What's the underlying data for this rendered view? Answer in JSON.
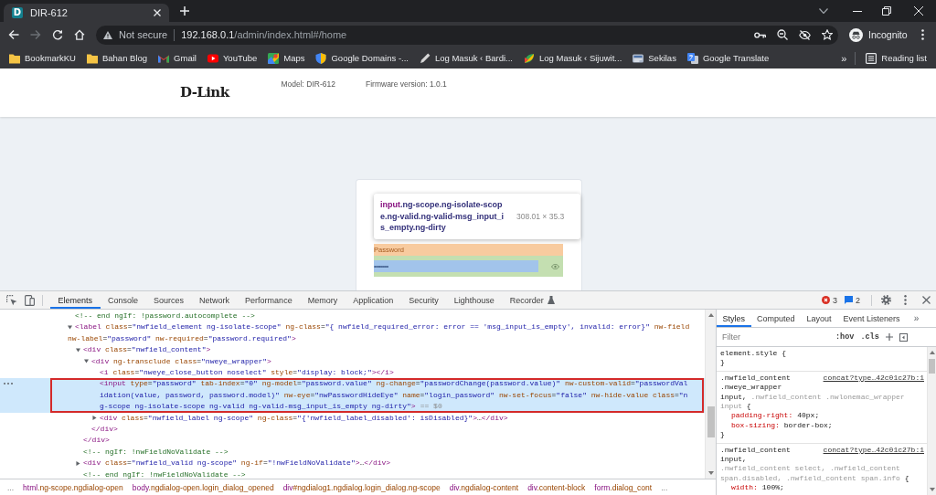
{
  "browser": {
    "tabs": [
      {
        "title": "DIR-612",
        "icon_letter": "D",
        "selected": true
      }
    ],
    "address": {
      "security": "Not secure",
      "host": "192.168.0.1",
      "path": "/admin/index.html#/home"
    },
    "profile": "Incognito",
    "bookmarks": [
      {
        "label": "BookmarkKU",
        "kind": "folder"
      },
      {
        "label": "Bahan Blog",
        "kind": "folder"
      },
      {
        "label": "Gmail",
        "kind": "mail"
      },
      {
        "label": "YouTube",
        "kind": "video"
      },
      {
        "label": "Maps",
        "kind": "map"
      },
      {
        "label": "Google Domains -...",
        "kind": "shield"
      },
      {
        "label": "Log Masuk ‹ Bardi...",
        "kind": "pen"
      },
      {
        "label": "Log Masuk ‹ Sijuwit...",
        "kind": "leaf"
      },
      {
        "label": "Sekilas",
        "kind": "news"
      },
      {
        "label": "Google Translate",
        "kind": "translate"
      }
    ],
    "bookmarks_overflow": "»",
    "reading_list": "Reading list"
  },
  "page": {
    "logo": "D-Link",
    "model": "Model: DIR-612",
    "firmware": "Firmware version: 1.0.1",
    "inspect_tooltip": {
      "tag": "input",
      "classes": ".ng-scope.ng-isolate-scope.ng-valid.ng-valid-msg_input_is_empty.ng-dirty",
      "size": "308.01 × 35.3"
    },
    "password_field": {
      "label": "Password",
      "value": "••••••••"
    }
  },
  "devtools": {
    "tabs": [
      {
        "label": "Elements",
        "selected": true,
        "experimental": false
      },
      {
        "label": "Console",
        "selected": false,
        "experimental": false
      },
      {
        "label": "Sources",
        "selected": false,
        "experimental": false
      },
      {
        "label": "Network",
        "selected": false,
        "experimental": false
      },
      {
        "label": "Performance",
        "selected": false,
        "experimental": false
      },
      {
        "label": "Memory",
        "selected": false,
        "experimental": false
      },
      {
        "label": "Application",
        "selected": false,
        "experimental": false
      },
      {
        "label": "Security",
        "selected": false,
        "experimental": false
      },
      {
        "label": "Lighthouse",
        "selected": false,
        "experimental": false
      },
      {
        "label": "Recorder",
        "selected": false,
        "experimental": true
      }
    ],
    "error_count": "3",
    "message_count": "2",
    "dom_tree": [
      {
        "kind": "comment",
        "selected": false,
        "lines": [
          "<!-- end ngIf: !password.autocomplete -->"
        ]
      },
      {
        "kind": "element",
        "selected": false,
        "expanded": true,
        "lines": [
          "<label class=\"nwfield_element ng-isolate-scope\" ng-class=\"{ nwfield_required_error: error == 'msg_input_is_empty', invalid: error}\" nw-field",
          "nw-label=\"password\" nw-required=\"password.required\">"
        ],
        "children": [
          {
            "kind": "element",
            "selected": false,
            "expanded": true,
            "lines": [
              "<div class=\"nwfield_content\">"
            ],
            "children": [
              {
                "kind": "element",
                "selected": false,
                "expanded": true,
                "lines": [
                  "<div ng-transclude class=\"nweye_wrapper\">"
                ],
                "children": [
                  {
                    "kind": "leaf",
                    "selected": false,
                    "lines": [
                      "<i class=\"nweye_close_button noselect\" style=\"display: block;\"></i>"
                    ]
                  },
                  {
                    "kind": "leaf",
                    "selected": true,
                    "lines": [
                      "<input type=\"password\" tab-index=\"0\" ng-model=\"password.value\" ng-change=\"passwordChange(password.value)\" nw-custom-valid=\"passwordVal",
                      "idation(value, password, password.model)\" nw-eye=\"nwPasswordHideEye\" name=\"login_password\" nw-set-focus=\"false\" nw-hide-value class=\"n",
                      "g-scope ng-isolate-scope ng-valid ng-valid-msg_input_is_empty ng-dirty\">"
                    ],
                    "marker": "== $0"
                  },
                  {
                    "kind": "element",
                    "selected": false,
                    "expanded": false,
                    "lines": [
                      "<div class=\"nwfield_label ng-scope\" ng-class=\"{'nwfield_label_disabled': isDisabled}\">…</div>"
                    ]
                  }
                ],
                "close": "</div>"
              }
            ],
            "close": "</div>"
          },
          {
            "kind": "comment",
            "selected": false,
            "lines": [
              "<!-- ngIf: !nwFieldNoValidate -->"
            ]
          },
          {
            "kind": "element",
            "selected": false,
            "expanded": false,
            "lines": [
              "<div class=\"nwfield_valid ng-scope\" ng-if=\"!nwFieldNoValidate\">…</div>"
            ]
          },
          {
            "kind": "comment",
            "selected": false,
            "lines": [
              "<!-- end ngIf: !nwFieldNoValidate -->"
            ]
          }
        ]
      }
    ],
    "breadcrumbs": {
      "scroll_left": "...",
      "items": [
        {
          "tag": "html",
          "rest": ".ng-scope.ngdialog-open"
        },
        {
          "tag": "body",
          "rest": ".ngdialog-open.login_dialog_opened"
        },
        {
          "tag": "div",
          "rest": "#ngdialog1.ngdialog.login_dialog.ng-scope"
        },
        {
          "tag": "div",
          "rest": ".ngdialog-content"
        },
        {
          "tag": "div",
          "rest": ".content-block"
        },
        {
          "tag": "form",
          "rest": ".dialog_cont"
        }
      ],
      "scroll_right": "..."
    },
    "styles_pane": {
      "tabs": [
        {
          "label": "Styles",
          "selected": true
        },
        {
          "label": "Computed",
          "selected": false
        },
        {
          "label": "Layout",
          "selected": false
        },
        {
          "label": "Event Listeners",
          "selected": false
        }
      ],
      "tabs_overflow": "»",
      "filter": {
        "placeholder": "Filter"
      },
      "hov": ":hov",
      "cls": ".cls",
      "rules": [
        {
          "selector_lines": [
            [
              {
                "text": "element.style {",
                "matched": true
              }
            ]
          ],
          "close": "}"
        },
        {
          "source": "concat?type…42c01c27b:1",
          "selector_lines": [
            [
              {
                "text": ".nwfield_content",
                "matched": true
              }
            ],
            [
              {
                "text": ".nweye_wrapper",
                "matched": true
              }
            ],
            [
              {
                "text": "input,",
                "matched": true
              },
              {
                "text": " .nwfield_content .nwlonemac_wrapper",
                "matched": false
              }
            ],
            [
              {
                "text": "input",
                "matched": false
              },
              {
                "text": " {",
                "matched": true
              }
            ]
          ],
          "properties": [
            {
              "name": "padding-right:",
              "value": "40px;"
            },
            {
              "name": "box-sizing:",
              "value": "border-box;"
            }
          ],
          "close": "}"
        },
        {
          "source": "concat?type…42c01c27b:1",
          "selector_lines": [
            [
              {
                "text": ".nwfield_content",
                "matched": true
              }
            ],
            [
              {
                "text": "input,",
                "matched": true
              }
            ],
            [
              {
                "text": ".nwfield_content select, .nwfield_content",
                "matched": false
              }
            ],
            [
              {
                "text": "span.disabled, .nwfield_content span.info",
                "matched": false
              },
              {
                "text": " {",
                "matched": true
              }
            ]
          ],
          "properties": [
            {
              "name": "width:",
              "value": "100%;"
            }
          ]
        }
      ]
    }
  }
}
